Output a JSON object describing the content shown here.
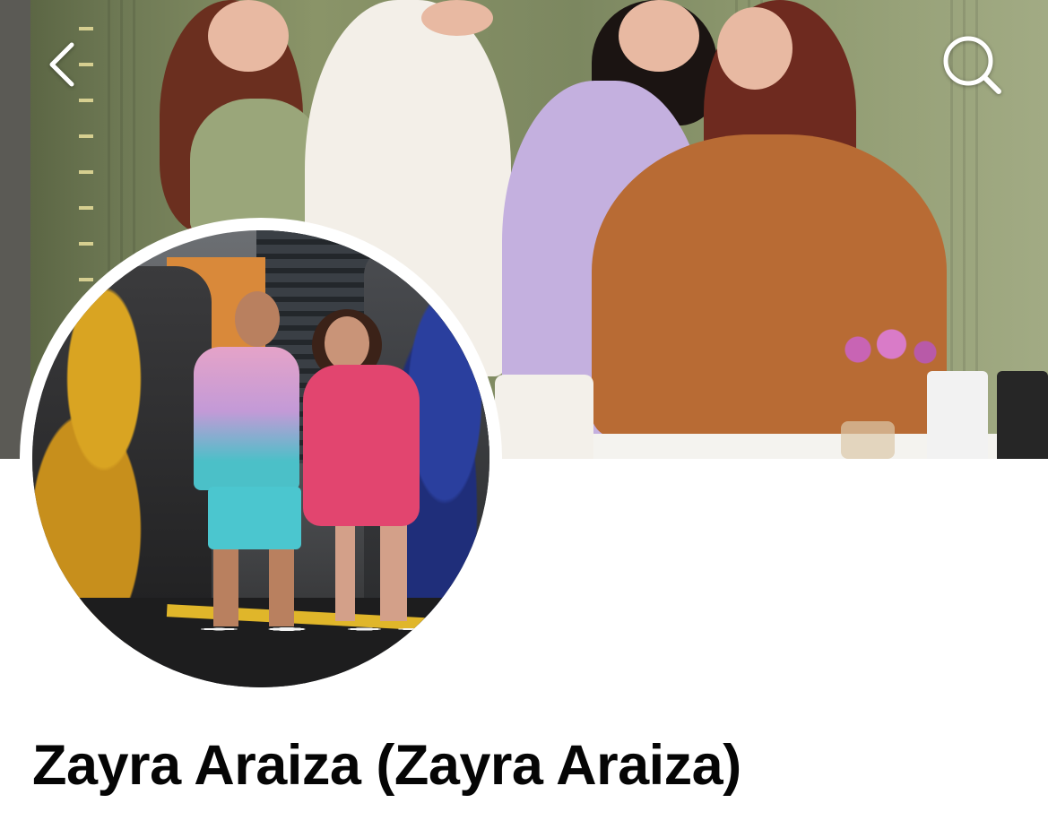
{
  "profile": {
    "name": "Zayra Araiza (Zayra Araiza)"
  },
  "header": {
    "back_icon": "chevron-left-icon",
    "search_icon": "search-icon"
  },
  "colors": {
    "background": "#ffffff",
    "name_text": "#050505",
    "icon": "#ffffff"
  }
}
